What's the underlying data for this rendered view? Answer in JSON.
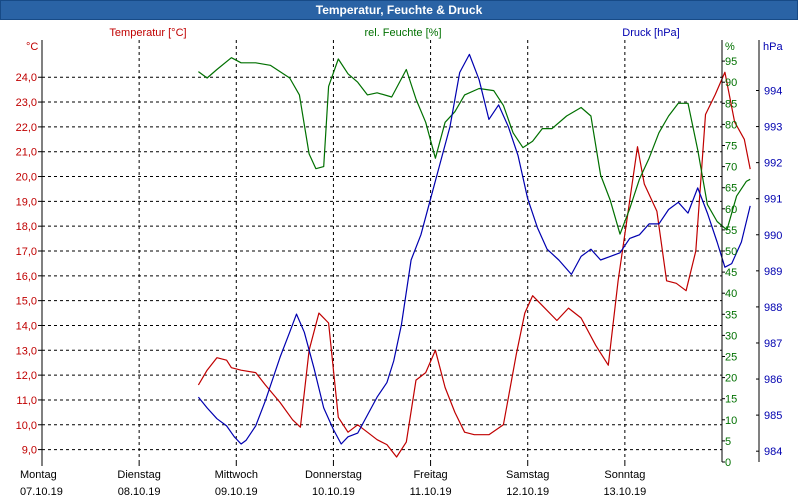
{
  "window": {
    "title": "Temperatur, Feuchte & Druck"
  },
  "colors": {
    "temperature": "#c00000",
    "humidity": "#007000",
    "pressure": "#0000b0",
    "title_bar": "#2a63a5",
    "grid": "#000000"
  },
  "chart_data": {
    "type": "line",
    "title": "Temperatur, Feuchte & Druck",
    "x_axis": {
      "days": [
        {
          "day": "Montag",
          "date": "07.10.19"
        },
        {
          "day": "Dienstag",
          "date": "08.10.19"
        },
        {
          "day": "Mittwoch",
          "date": "09.10.19"
        },
        {
          "day": "Donnerstag",
          "date": "10.10.19"
        },
        {
          "day": "Freitag",
          "date": "11.10.19"
        },
        {
          "day": "Samstag",
          "date": "12.10.19"
        },
        {
          "day": "Sonntag",
          "date": "13.10.19"
        }
      ],
      "range_days": [
        0,
        7
      ],
      "grid": "dashed"
    },
    "axes": {
      "temperature": {
        "label": "Temperatur [°C]",
        "unit": "°C",
        "range": [
          8.5,
          25.5
        ],
        "ticks": [
          "9,0",
          "10,0",
          "11,0",
          "12,0",
          "13,0",
          "14,0",
          "15,0",
          "16,0",
          "17,0",
          "18,0",
          "19,0",
          "20,0",
          "21,0",
          "22,0",
          "23,0",
          "24,0"
        ],
        "position": "left"
      },
      "humidity": {
        "label": "rel. Feuchte [%]",
        "unit": "%",
        "range": [
          0,
          100
        ],
        "ticks": [
          "0",
          "5",
          "10",
          "15",
          "20",
          "25",
          "30",
          "35",
          "40",
          "45",
          "50",
          "55",
          "60",
          "65",
          "70",
          "75",
          "80",
          "85",
          "90",
          "95"
        ],
        "position": "right"
      },
      "pressure": {
        "label": "Druck [hPa]",
        "unit": "hPa",
        "range": [
          983.7,
          995.4
        ],
        "ticks": [
          "984",
          "985",
          "986",
          "987",
          "988",
          "989",
          "990",
          "991",
          "992",
          "993",
          "994"
        ],
        "position": "far-right"
      }
    },
    "series": [
      {
        "name": "Temperatur [°C]",
        "axis": "temperature",
        "points": [
          [
            1.61,
            11.6
          ],
          [
            1.7,
            12.2
          ],
          [
            1.8,
            12.7
          ],
          [
            1.9,
            12.6
          ],
          [
            1.95,
            12.3
          ],
          [
            2.05,
            12.2
          ],
          [
            2.2,
            12.1
          ],
          [
            2.3,
            11.6
          ],
          [
            2.45,
            10.9
          ],
          [
            2.58,
            10.2
          ],
          [
            2.66,
            9.9
          ],
          [
            2.75,
            13.0
          ],
          [
            2.85,
            14.5
          ],
          [
            2.95,
            14.1
          ],
          [
            3.05,
            10.3
          ],
          [
            3.15,
            9.7
          ],
          [
            3.25,
            10.0
          ],
          [
            3.35,
            9.7
          ],
          [
            3.45,
            9.4
          ],
          [
            3.55,
            9.2
          ],
          [
            3.65,
            8.7
          ],
          [
            3.75,
            9.3
          ],
          [
            3.85,
            11.8
          ],
          [
            3.95,
            12.1
          ],
          [
            4.05,
            13.0
          ],
          [
            4.15,
            11.5
          ],
          [
            4.25,
            10.5
          ],
          [
            4.35,
            9.7
          ],
          [
            4.45,
            9.6
          ],
          [
            4.6,
            9.6
          ],
          [
            4.75,
            10.0
          ],
          [
            4.88,
            12.8
          ],
          [
            4.97,
            14.5
          ],
          [
            5.05,
            15.2
          ],
          [
            5.15,
            14.8
          ],
          [
            5.3,
            14.2
          ],
          [
            5.42,
            14.7
          ],
          [
            5.55,
            14.3
          ],
          [
            5.7,
            13.2
          ],
          [
            5.83,
            12.4
          ],
          [
            5.93,
            15.8
          ],
          [
            6.03,
            18.5
          ],
          [
            6.13,
            21.2
          ],
          [
            6.2,
            19.7
          ],
          [
            6.33,
            18.6
          ],
          [
            6.43,
            15.8
          ],
          [
            6.53,
            15.7
          ],
          [
            6.63,
            15.4
          ],
          [
            6.73,
            17.0
          ],
          [
            6.83,
            22.5
          ],
          [
            6.93,
            23.3
          ],
          [
            7.03,
            24.2
          ],
          [
            7.13,
            22.2
          ],
          [
            7.23,
            21.5
          ],
          [
            7.29,
            20.3
          ]
        ]
      },
      {
        "name": "rel. Feuchte [%]",
        "axis": "humidity",
        "points": [
          [
            1.61,
            92.5
          ],
          [
            1.7,
            91.0
          ],
          [
            1.8,
            93.0
          ],
          [
            1.95,
            95.8
          ],
          [
            2.05,
            94.6
          ],
          [
            2.2,
            94.6
          ],
          [
            2.35,
            94.0
          ],
          [
            2.55,
            91.0
          ],
          [
            2.65,
            87.0
          ],
          [
            2.75,
            73.0
          ],
          [
            2.82,
            69.5
          ],
          [
            2.9,
            70.0
          ],
          [
            2.95,
            89.0
          ],
          [
            3.05,
            95.5
          ],
          [
            3.15,
            92.0
          ],
          [
            3.25,
            90.0
          ],
          [
            3.35,
            87.0
          ],
          [
            3.45,
            87.5
          ],
          [
            3.6,
            86.5
          ],
          [
            3.75,
            93.0
          ],
          [
            3.85,
            86.0
          ],
          [
            3.95,
            80.5
          ],
          [
            4.05,
            72.0
          ],
          [
            4.15,
            80.5
          ],
          [
            4.25,
            83.0
          ],
          [
            4.35,
            87.0
          ],
          [
            4.5,
            88.5
          ],
          [
            4.65,
            88.0
          ],
          [
            4.75,
            84.5
          ],
          [
            4.85,
            78.0
          ],
          [
            4.95,
            74.5
          ],
          [
            5.05,
            76.0
          ],
          [
            5.15,
            79.0
          ],
          [
            5.25,
            79.0
          ],
          [
            5.4,
            82.0
          ],
          [
            5.55,
            84.0
          ],
          [
            5.65,
            82.0
          ],
          [
            5.75,
            68.0
          ],
          [
            5.85,
            62.0
          ],
          [
            5.95,
            54.0
          ],
          [
            6.05,
            60.0
          ],
          [
            6.15,
            67.0
          ],
          [
            6.25,
            72.0
          ],
          [
            6.35,
            78.0
          ],
          [
            6.45,
            82.0
          ],
          [
            6.55,
            85.0
          ],
          [
            6.65,
            85.0
          ],
          [
            6.75,
            74.0
          ],
          [
            6.85,
            61.0
          ],
          [
            6.95,
            57.0
          ],
          [
            7.05,
            55.0
          ],
          [
            7.15,
            63.0
          ],
          [
            7.25,
            66.5
          ],
          [
            7.29,
            67.0
          ]
        ]
      },
      {
        "name": "Druck [hPa]",
        "axis": "pressure",
        "points": [
          [
            1.61,
            985.5
          ],
          [
            1.7,
            985.2
          ],
          [
            1.8,
            984.9
          ],
          [
            1.9,
            984.7
          ],
          [
            1.98,
            984.4
          ],
          [
            2.05,
            984.2
          ],
          [
            2.1,
            984.3
          ],
          [
            2.2,
            984.7
          ],
          [
            2.3,
            985.4
          ],
          [
            2.45,
            986.6
          ],
          [
            2.55,
            987.3
          ],
          [
            2.62,
            987.8
          ],
          [
            2.7,
            987.3
          ],
          [
            2.8,
            986.3
          ],
          [
            2.9,
            985.2
          ],
          [
            3.0,
            984.6
          ],
          [
            3.08,
            984.2
          ],
          [
            3.15,
            984.4
          ],
          [
            3.25,
            984.5
          ],
          [
            3.35,
            985.0
          ],
          [
            3.45,
            985.5
          ],
          [
            3.55,
            985.9
          ],
          [
            3.62,
            986.5
          ],
          [
            3.7,
            987.5
          ],
          [
            3.8,
            989.3
          ],
          [
            3.9,
            990.0
          ],
          [
            4.0,
            991.0
          ],
          [
            4.1,
            992.0
          ],
          [
            4.2,
            993.0
          ],
          [
            4.3,
            994.5
          ],
          [
            4.4,
            995.0
          ],
          [
            4.5,
            994.3
          ],
          [
            4.6,
            993.2
          ],
          [
            4.7,
            993.6
          ],
          [
            4.8,
            993.0
          ],
          [
            4.9,
            992.2
          ],
          [
            5.0,
            991.0
          ],
          [
            5.1,
            990.2
          ],
          [
            5.2,
            989.6
          ],
          [
            5.32,
            989.3
          ],
          [
            5.45,
            988.9
          ],
          [
            5.55,
            989.4
          ],
          [
            5.65,
            989.6
          ],
          [
            5.75,
            989.3
          ],
          [
            5.85,
            989.4
          ],
          [
            5.95,
            989.5
          ],
          [
            6.05,
            989.9
          ],
          [
            6.15,
            990.0
          ],
          [
            6.25,
            990.3
          ],
          [
            6.35,
            990.3
          ],
          [
            6.45,
            990.7
          ],
          [
            6.55,
            990.9
          ],
          [
            6.65,
            990.6
          ],
          [
            6.75,
            991.3
          ],
          [
            6.85,
            990.6
          ],
          [
            6.95,
            989.8
          ],
          [
            7.03,
            989.1
          ],
          [
            7.1,
            989.2
          ],
          [
            7.2,
            989.8
          ],
          [
            7.29,
            990.8
          ]
        ]
      }
    ]
  }
}
